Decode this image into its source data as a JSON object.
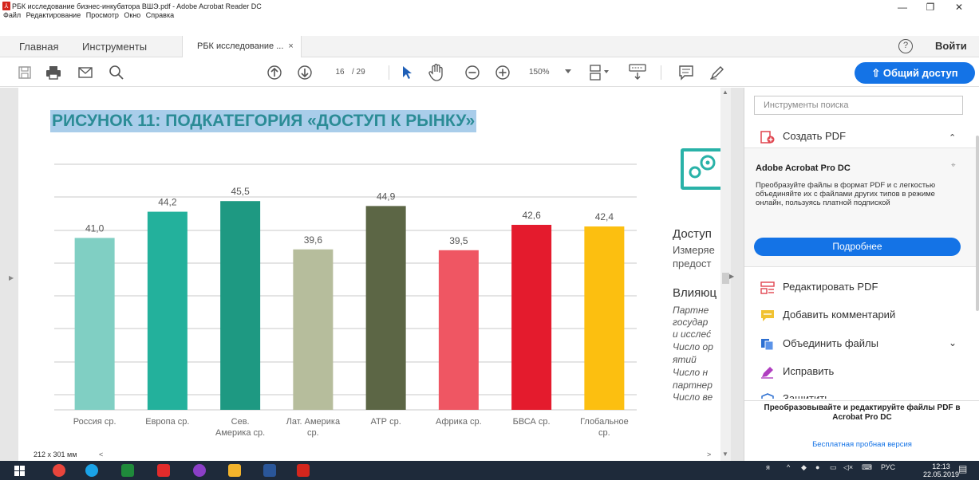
{
  "window": {
    "title": "РБК исследование бизнес-инкубатора ВШЭ.pdf - Adobe Acrobat Reader DC",
    "minimize": "—",
    "maximize": "❐",
    "close": "✕"
  },
  "menu": [
    "Файл",
    "Редактирование",
    "Просмотр",
    "Окно",
    "Справка"
  ],
  "tabs": {
    "home": "Главная",
    "tools": "Инструменты",
    "document": "РБК исследование ...",
    "close": "×",
    "help": "?",
    "signin": "Войти"
  },
  "toolbar": {
    "page_current": "16",
    "page_total": "/ 29",
    "zoom": "150%",
    "share": "Общий доступ"
  },
  "document": {
    "figure_title_selected": "РИСУНО",
    "figure_title_rest": "К 11: ПОДКАТЕГОРИЯ «ДОСТУП К РЫНКУ»",
    "side_lines": [
      "Доступ",
      "Измеряе",
      "предост",
      "Влияюц",
      "Партне",
      "государ",
      "и исслеć",
      "Число ор",
      "ятий",
      "Число н",
      "партнер",
      "Число ве"
    ],
    "page_size": "212 x 301 мм"
  },
  "chart_data": {
    "type": "bar",
    "categories": [
      "Россия ср.",
      "Европа ср.",
      "Сев. Америка ср.",
      "Лат. Америка ср.",
      "АТР ср.",
      "Африка ср.",
      "БВСА ср.",
      "Глобальное ср."
    ],
    "category_lines": [
      [
        "Россия ср."
      ],
      [
        "Европа ср."
      ],
      [
        "Сев.",
        "Америка ср."
      ],
      [
        "Лат. Америка",
        "ср."
      ],
      [
        "АТР ср."
      ],
      [
        "Африка ср."
      ],
      [
        "БВСА ср."
      ],
      [
        "Глобальное",
        "ср."
      ]
    ],
    "values": [
      41.0,
      44.2,
      45.5,
      39.6,
      44.9,
      39.5,
      42.6,
      42.4
    ],
    "labels": [
      "41,0",
      "44,2",
      "45,5",
      "39,6",
      "44,9",
      "39,5",
      "42,6",
      "42,4"
    ],
    "colors": [
      "#80cfc3",
      "#23b19c",
      "#1e9982",
      "#b6bd9c",
      "#5c6645",
      "#ef5663",
      "#e41b2d",
      "#fcbf10"
    ],
    "ylim": [
      20,
      50
    ],
    "grid": true
  },
  "panel": {
    "search_placeholder": "Инструменты поиска",
    "create_pdf": "Создать PDF",
    "pro_title": "Adobe Acrobat Pro DC",
    "pro_desc": "Преобразуйте файлы в формат PDF и с легкостью объединяйте их с файлами других типов в режиме онлайн, пользуясь платной подпиской",
    "more": "Подробнее",
    "edit_pdf": "Редактировать PDF",
    "add_comment": "Добавить комментарий",
    "combine": "Объединить файлы",
    "fix": "Исправить",
    "protect": "Защитить",
    "promo": "Преобразовывайте и редактируйте файлы PDF в Acrobat Pro DC",
    "trial": "Бесплатная пробная версия"
  },
  "taskbar": {
    "lang": "РУС",
    "time": "12:13",
    "date": "22.05.2019"
  }
}
